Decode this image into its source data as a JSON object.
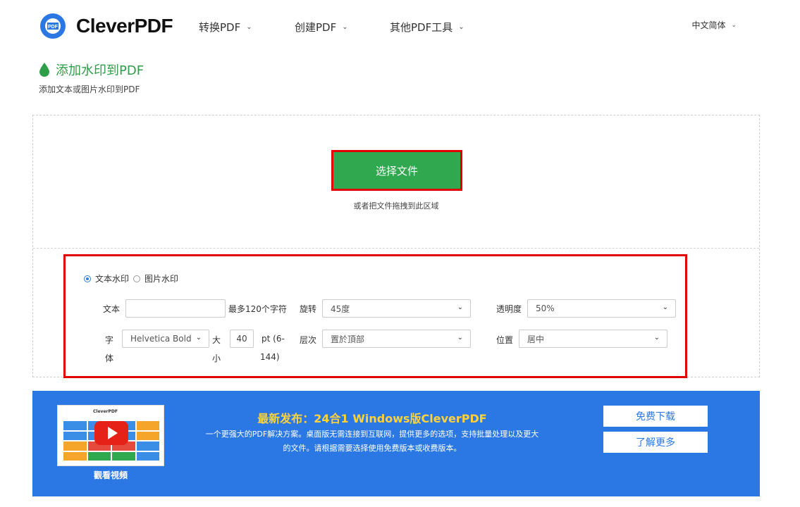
{
  "header": {
    "logo_text": "CleverPDF",
    "nav": [
      {
        "label": "转换PDF"
      },
      {
        "label": "创建PDF"
      },
      {
        "label": "其他PDF工具"
      }
    ],
    "language": "中文简体"
  },
  "page": {
    "title": "添加水印到PDF",
    "subtitle": "添加文本或图片水印到PDF"
  },
  "upload": {
    "choose_button": "选择文件",
    "drop_hint": "或者把文件拖拽到此区域"
  },
  "options": {
    "mode": {
      "text_label": "文本水印",
      "image_label": "图片水印",
      "selected": "text"
    },
    "text": {
      "label": "文本",
      "value": "",
      "hint": "最多120个字符"
    },
    "rotate": {
      "label": "旋转",
      "value": "45度"
    },
    "opacity": {
      "label": "透明度",
      "value": "50%"
    },
    "font": {
      "label_line1": "字",
      "label_line2": "体",
      "value": "Helvetica Bold"
    },
    "size": {
      "label_line1": "大",
      "label_line2": "小",
      "value": "40",
      "unit_line1": "pt (6-",
      "unit_line2": "144)"
    },
    "layer": {
      "label": "层次",
      "value": "置於頂部"
    },
    "position": {
      "label": "位置",
      "value": "居中"
    }
  },
  "promo": {
    "thumb_title": "CleverPDF",
    "watch_label": "觀看視頻",
    "title": "最新发布：24合1 Windows版CleverPDF",
    "desc_line1": "一个更强大的PDF解决方案。桌面版无需连接到互联网，提供更多的选项，支持批量处理以及更大",
    "desc_line2": "的文件。请根据需要选择使用免费版本或收费版本。",
    "download_button": "免费下载",
    "learn_button": "了解更多"
  },
  "colors": {
    "brand_blue": "#2b78e4",
    "green": "#2fa84f",
    "highlight_red": "#e00000",
    "promo_title_yellow": "#ffd23c"
  }
}
